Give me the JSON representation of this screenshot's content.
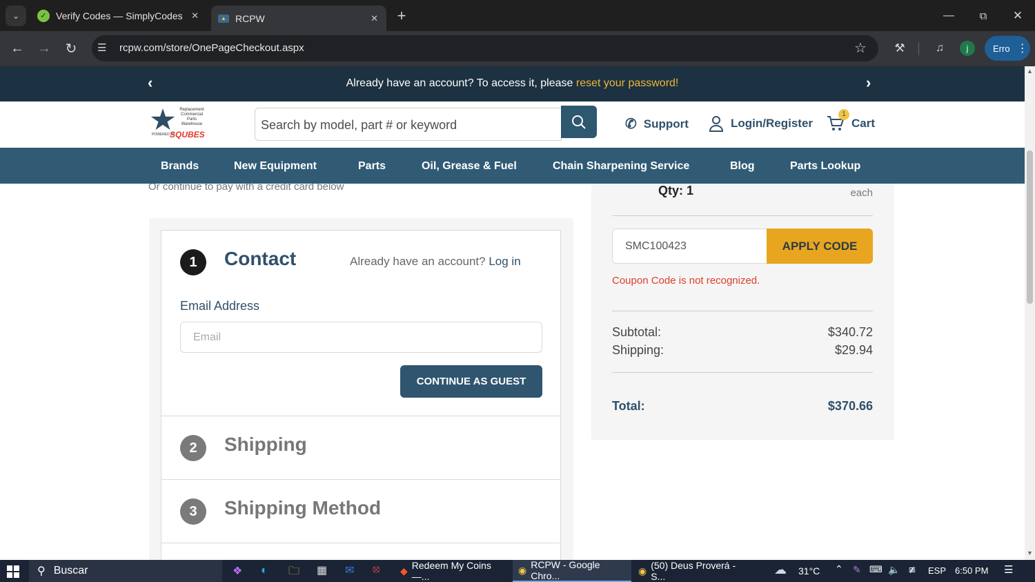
{
  "browser": {
    "tabs": [
      {
        "title": "Verify Codes — SimplyCodes",
        "active": false
      },
      {
        "title": "RCPW",
        "active": true
      }
    ],
    "url": "rcpw.com/store/OnePageCheckout.aspx",
    "profile_initial": "j",
    "profile_label": "Erro"
  },
  "announcement": {
    "text": "Already have an account? To access it, please",
    "link": "reset your password!"
  },
  "header": {
    "logo_lines": [
      "Replacement",
      "Commercial",
      "Parts",
      "Warehouse"
    ],
    "logo_powered": "POWERED BY",
    "logo_brand": "SQUBES",
    "search_placeholder": "Search by model, part # or keyword",
    "support_label": "Support",
    "login_label": "Login/Register",
    "cart_label": "Cart",
    "cart_count": "1"
  },
  "nav": [
    "Brands",
    "New Equipment",
    "Parts",
    "Oil, Grease & Fuel",
    "Chain Sharpening Service",
    "Blog",
    "Parts Lookup"
  ],
  "checkout": {
    "credit_note": "Or continue to pay with a credit card below",
    "contact": {
      "number": "1",
      "title": "Contact",
      "account_prompt": "Already have an account?",
      "login_link": "Log in",
      "email_label": "Email Address",
      "email_placeholder": "Email",
      "guest_button": "CONTINUE AS GUEST"
    },
    "shipping": {
      "number": "2",
      "title": "Shipping"
    },
    "shipping_method": {
      "number": "3",
      "title": "Shipping Method"
    }
  },
  "summary": {
    "qty": "Qty: 1",
    "each": "each",
    "coupon_value": "SMC100423",
    "apply_button": "APPLY CODE",
    "coupon_error": "Coupon Code is not recognized.",
    "subtotal_label": "Subtotal:",
    "subtotal_value": "$340.72",
    "shipping_label": "Shipping:",
    "shipping_value": "$29.94",
    "total_label": "Total:",
    "total_value": "$370.66"
  },
  "taskbar": {
    "search": "Buscar",
    "apps": [
      "Redeem My Coins —...",
      "RCPW - Google Chro...",
      "(50) Deus Proverá - S..."
    ],
    "temperature": "31°C",
    "language": "ESP",
    "time": "6:50 PM"
  },
  "colors": {
    "accent_gold": "#e8a520",
    "nav_blue": "#315b75",
    "announce_bg": "#1c3141",
    "error_red": "#d9402b"
  }
}
